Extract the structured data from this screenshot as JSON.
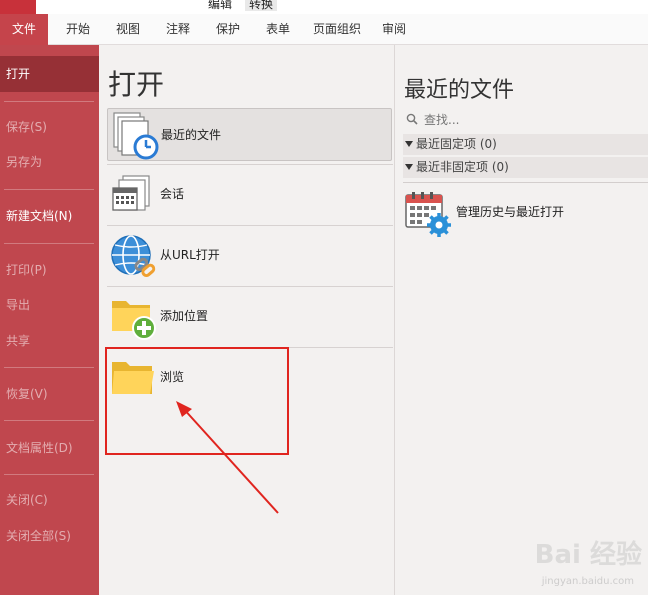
{
  "top_strip": {
    "context_left": "编辑",
    "context_right": "转换"
  },
  "ribbon": {
    "tabs": [
      {
        "label": "文件"
      },
      {
        "label": "开始"
      },
      {
        "label": "视图"
      },
      {
        "label": "注释"
      },
      {
        "label": "保护"
      },
      {
        "label": "表单"
      },
      {
        "label": "页面组织"
      },
      {
        "label": "审阅"
      }
    ]
  },
  "sidebar": {
    "items": [
      {
        "label": "打开"
      },
      {
        "label": "保存(S)"
      },
      {
        "label": "另存为"
      },
      {
        "label": "新建文档(N)"
      },
      {
        "label": "打印(P)"
      },
      {
        "label": "导出"
      },
      {
        "label": "共享"
      },
      {
        "label": "恢复(V)"
      },
      {
        "label": "文档属性(D)"
      },
      {
        "label": "关闭(C)"
      },
      {
        "label": "关闭全部(S)"
      }
    ]
  },
  "open_panel": {
    "title": "打开",
    "options": [
      {
        "label": "最近的文件"
      },
      {
        "label": "会话"
      },
      {
        "label": "从URL打开"
      },
      {
        "label": "添加位置"
      },
      {
        "label": "浏览"
      }
    ]
  },
  "recent_panel": {
    "title": "最近的文件",
    "search_placeholder": "查找...",
    "groups": [
      {
        "label": "最近固定项 (0)"
      },
      {
        "label": "最近非固定项 (0)"
      }
    ],
    "manage_label": "管理历史与最近打开"
  },
  "watermark": {
    "text": "Bai 经验",
    "url": "jingyan.baidu.com"
  },
  "colors": {
    "accent": "#c0474e",
    "accent_dark": "#963036",
    "highlight": "#e0251f"
  }
}
